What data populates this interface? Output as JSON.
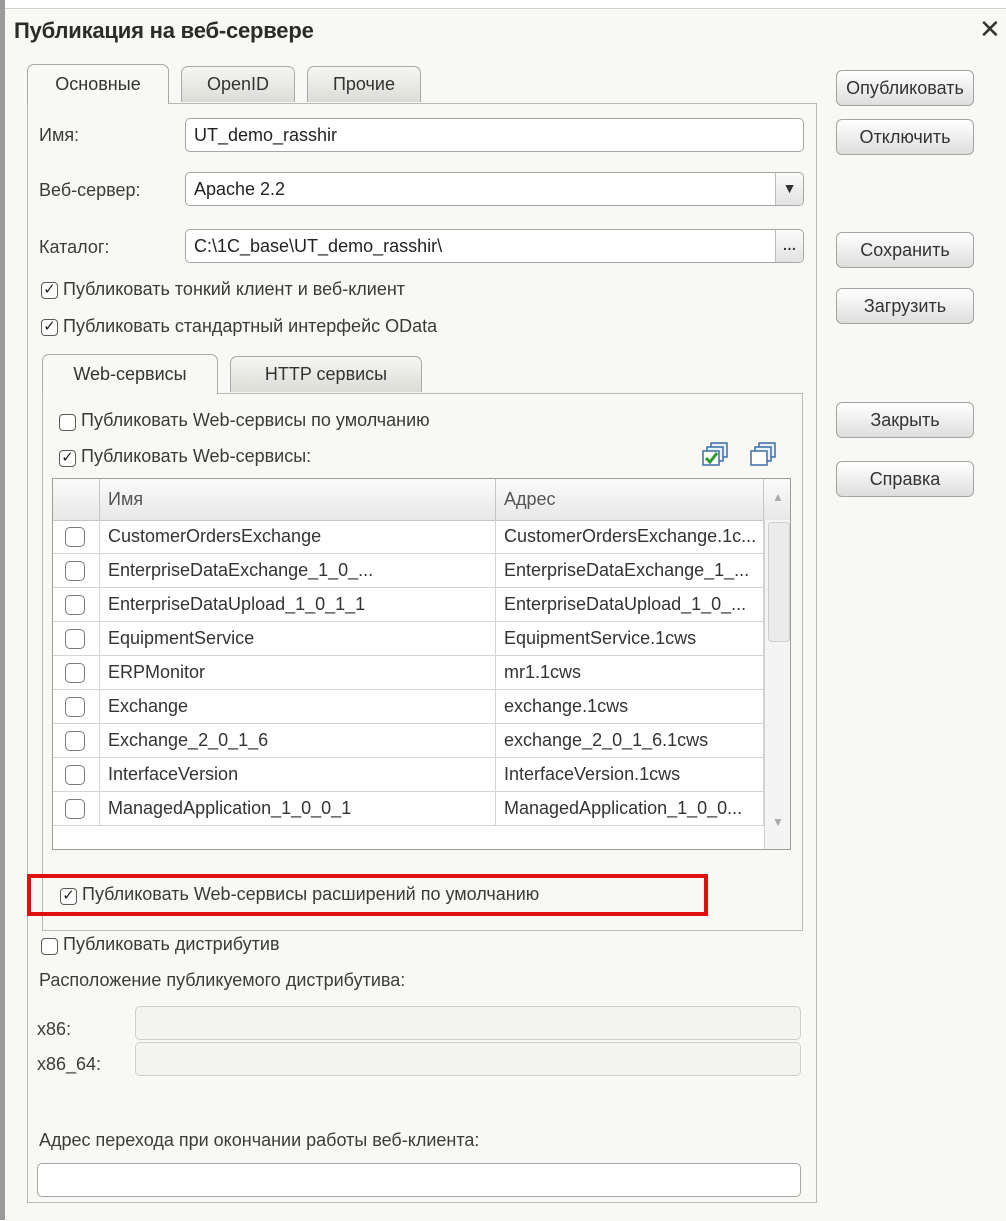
{
  "window": {
    "title": "Публикация на веб-сервере",
    "close_glyph": "✕"
  },
  "tabs": [
    {
      "label": "Основные"
    },
    {
      "label": "OpenID"
    },
    {
      "label": "Прочие"
    }
  ],
  "fields": {
    "name": {
      "label": "Имя:",
      "value": "UT_demo_rasshir"
    },
    "web_server": {
      "label": "Веб-сервер:",
      "value": "Apache 2.2"
    },
    "catalog": {
      "label": "Каталог:",
      "value": "C:\\1C_base\\UT_demo_rasshir\\"
    }
  },
  "options": {
    "thin_client": {
      "label": "Публиковать тонкий клиент и веб-клиент",
      "checked": true
    },
    "odata": {
      "label": "Публиковать стандартный интерфейс OData",
      "checked": true
    }
  },
  "subtabs": [
    {
      "label": "Web-сервисы"
    },
    {
      "label": "HTTP сервисы"
    }
  ],
  "web_services": {
    "publish_default": {
      "label": "Публиковать Web-сервисы по умолчанию",
      "checked": false
    },
    "publish": {
      "label": "Публиковать Web-сервисы:",
      "checked": true
    },
    "columns": [
      "Имя",
      "Адрес"
    ],
    "rows": [
      {
        "name": "CustomerOrdersExchange",
        "address": "CustomerOrdersExchange.1c...",
        "checked": false
      },
      {
        "name": "EnterpriseDataExchange_1_0_...",
        "address": "EnterpriseDataExchange_1_...",
        "checked": false
      },
      {
        "name": "EnterpriseDataUpload_1_0_1_1",
        "address": "EnterpriseDataUpload_1_0_...",
        "checked": false
      },
      {
        "name": "EquipmentService",
        "address": "EquipmentService.1cws",
        "checked": false
      },
      {
        "name": "ERPMonitor",
        "address": "mr1.1cws",
        "checked": false
      },
      {
        "name": "Exchange",
        "address": "exchange.1cws",
        "checked": false
      },
      {
        "name": "Exchange_2_0_1_6",
        "address": "exchange_2_0_1_6.1cws",
        "checked": false
      },
      {
        "name": "InterfaceVersion",
        "address": "InterfaceVersion.1cws",
        "checked": false
      },
      {
        "name": "ManagedApplication_1_0_0_1",
        "address": "ManagedApplication_1_0_0...",
        "checked": false
      }
    ],
    "extensions_default": {
      "label": "Публиковать Web-сервисы расширений по умолчанию",
      "checked": true
    }
  },
  "distributive": {
    "publish": {
      "label": "Публиковать дистрибутив",
      "checked": false
    },
    "location_label": "Расположение публикуемого дистрибутива:",
    "x86_label": "x86:",
    "x86_value": "",
    "x86_64_label": "x86_64:",
    "x86_64_value": ""
  },
  "exit_address": {
    "label": "Адрес перехода при окончании работы веб-клиента:",
    "value": ""
  },
  "buttons": {
    "publish": "Опубликовать",
    "disable": "Отключить",
    "save": "Сохранить",
    "load": "Загрузить",
    "close": "Закрыть",
    "help": "Справка"
  },
  "colors": {
    "highlight": "#e01010",
    "panel": "#f8f8f4"
  }
}
